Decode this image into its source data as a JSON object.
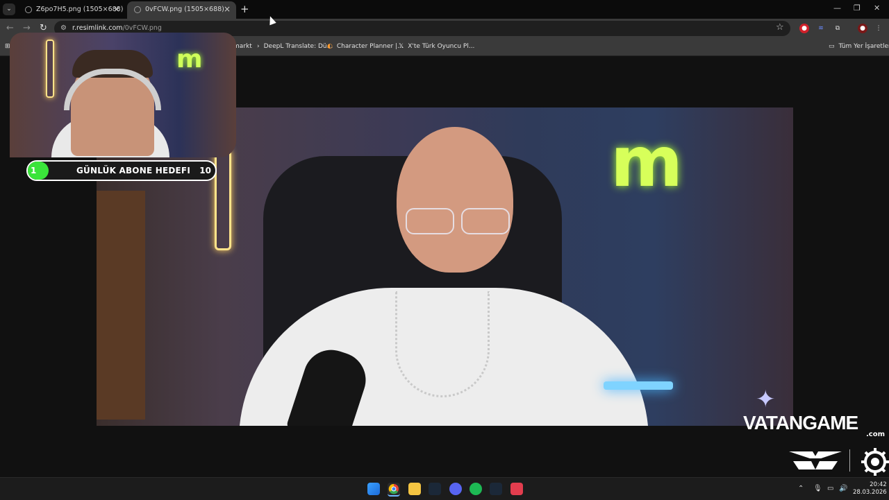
{
  "browser": {
    "tabs": [
      {
        "title": "Z6po7H5.png (1505×688)",
        "active": false
      },
      {
        "title": "0vFCW.png (1505×688)",
        "active": true
      }
    ],
    "address": {
      "domain": "r.resimlink.com",
      "path": "/0vFCW.png"
    },
    "bookmarks": [
      "markt",
      "DeepL Translate: Dü...",
      "Character Planner |...",
      "X'te Türk Oyuncu Pl..."
    ],
    "bookmarks_folder": "Tüm Yer İşaretleri"
  },
  "overlay": {
    "goal_label": "GÜNLÜK ABONE HEDEFI",
    "goal_current": "1",
    "goal_target": "10",
    "goal_progress": 0.1
  },
  "sponsors": {
    "vatangame": "VATANGAME",
    "vatangame_sub": ".com"
  },
  "taskbar": {
    "time": "20:42",
    "date": "28.03.2026"
  },
  "colors": {
    "goal_fill": "#3ae43a",
    "accent_neon": "#d7ff5a"
  }
}
